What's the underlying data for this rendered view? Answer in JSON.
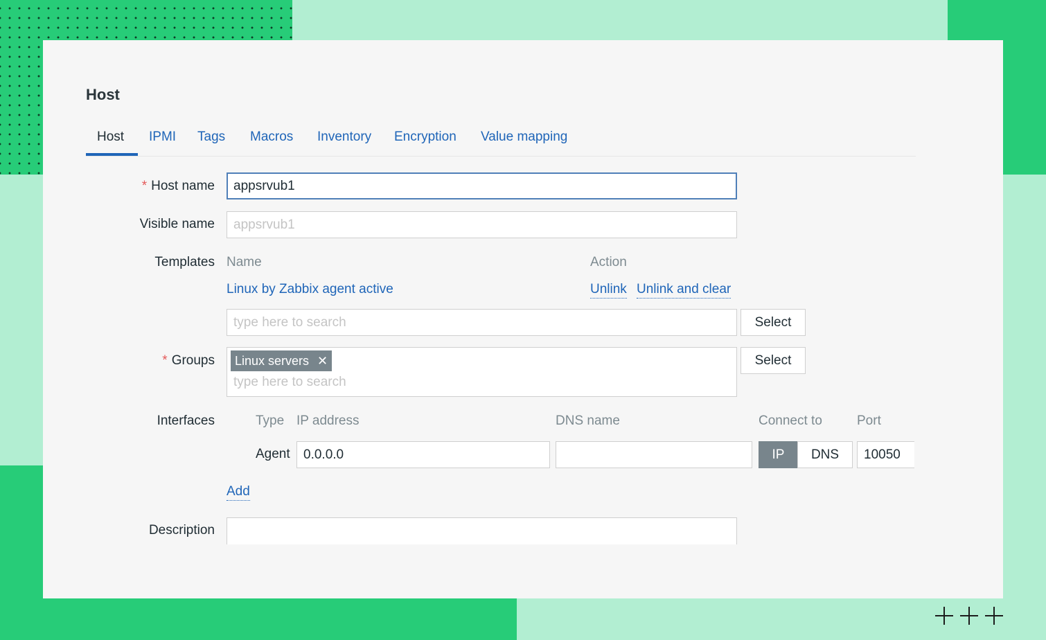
{
  "page": {
    "title": "Host",
    "tabs": [
      {
        "label": "Host",
        "active": true
      },
      {
        "label": "IPMI"
      },
      {
        "label": "Tags"
      },
      {
        "label": "Macros"
      },
      {
        "label": "Inventory"
      },
      {
        "label": "Encryption"
      },
      {
        "label": "Value mapping"
      }
    ]
  },
  "form": {
    "required_mark": "*",
    "host_name": {
      "label": "Host name",
      "value": "appsrvub1"
    },
    "visible_name": {
      "label": "Visible name",
      "placeholder": "appsrvub1"
    },
    "templates": {
      "label": "Templates",
      "col_name": "Name",
      "col_action": "Action",
      "rows": [
        {
          "name": "Linux by Zabbix agent active",
          "unlink": "Unlink",
          "unlink_clear": "Unlink and clear"
        }
      ],
      "search_placeholder": "type here to search",
      "select_label": "Select"
    },
    "groups": {
      "label": "Groups",
      "chips": [
        {
          "label": "Linux servers",
          "remove_icon": "close-icon"
        }
      ],
      "remove_glyph": "✕",
      "search_placeholder": "type here to search",
      "select_label": "Select"
    },
    "interfaces": {
      "label": "Interfaces",
      "col_type": "Type",
      "col_ip": "IP address",
      "col_dns": "DNS name",
      "col_connect": "Connect to",
      "col_port": "Port",
      "rows": [
        {
          "type": "Agent",
          "ip": "0.0.0.0",
          "dns": "",
          "connect_ip": "IP",
          "connect_dns": "DNS",
          "connect_selected": "IP",
          "port": "10050"
        }
      ],
      "add_label": "Add"
    },
    "description": {
      "label": "Description",
      "value": ""
    }
  },
  "colors": {
    "accent_green": "#27cc78",
    "light_green": "#b2eed2",
    "link_blue": "#1f65b8",
    "chip_gray": "#78858c",
    "required_red": "#e45959"
  }
}
